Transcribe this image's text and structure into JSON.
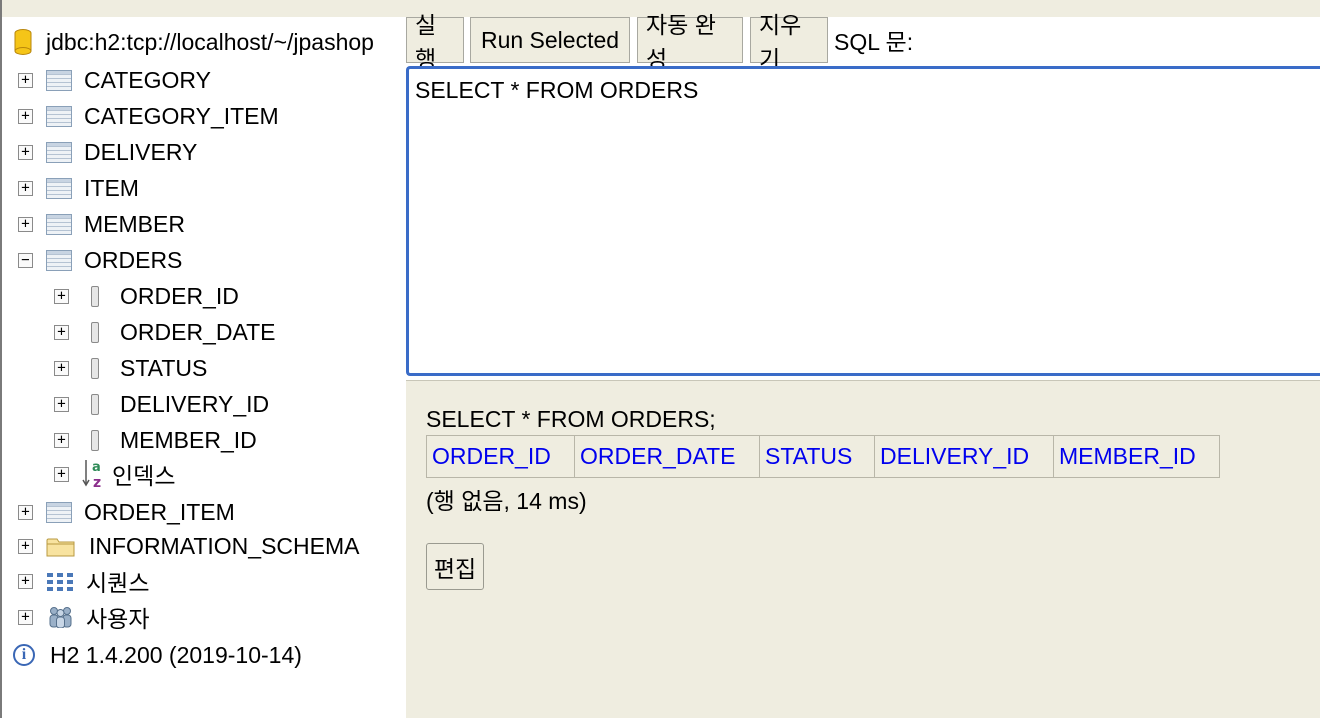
{
  "tree": {
    "connection": "jdbc:h2:tcp://localhost/~/jpashop",
    "tables": [
      {
        "label": "CATEGORY",
        "expander": "+"
      },
      {
        "label": "CATEGORY_ITEM",
        "expander": "+"
      },
      {
        "label": "DELIVERY",
        "expander": "+"
      },
      {
        "label": "ITEM",
        "expander": "+"
      },
      {
        "label": "MEMBER",
        "expander": "+"
      },
      {
        "label": "ORDERS",
        "expander": "−"
      }
    ],
    "orders_columns": [
      {
        "label": "ORDER_ID",
        "expander": "+"
      },
      {
        "label": "ORDER_DATE",
        "expander": "+"
      },
      {
        "label": "STATUS",
        "expander": "+"
      },
      {
        "label": "DELIVERY_ID",
        "expander": "+"
      },
      {
        "label": "MEMBER_ID",
        "expander": "+"
      }
    ],
    "index_label": "인덱스",
    "index_expander": "+",
    "order_item": {
      "label": "ORDER_ITEM",
      "expander": "+"
    },
    "information_schema": {
      "label": "INFORMATION_SCHEMA",
      "expander": "+"
    },
    "sequences": {
      "label": "시퀀스",
      "expander": "+"
    },
    "users": {
      "label": "사용자",
      "expander": "+"
    },
    "version": "H2 1.4.200 (2019-10-14)"
  },
  "toolbar": {
    "run_label": "실행",
    "run_selected_label": "Run Selected",
    "autocomplete_label": "자동 완성",
    "clear_label": "지우기",
    "sql_label": "SQL 문:"
  },
  "editor": {
    "sql_text": "SELECT * FROM ORDERS"
  },
  "result": {
    "query": "SELECT * FROM ORDERS;",
    "columns": [
      "ORDER_ID",
      "ORDER_DATE",
      "STATUS",
      "DELIVERY_ID",
      "MEMBER_ID"
    ],
    "footer": "(행 없음, 14 ms)",
    "edit_label": "편집"
  },
  "colors": {
    "panel_bg": "#efede0",
    "editor_border": "#3a6cc8",
    "link_blue": "#0000ee"
  }
}
